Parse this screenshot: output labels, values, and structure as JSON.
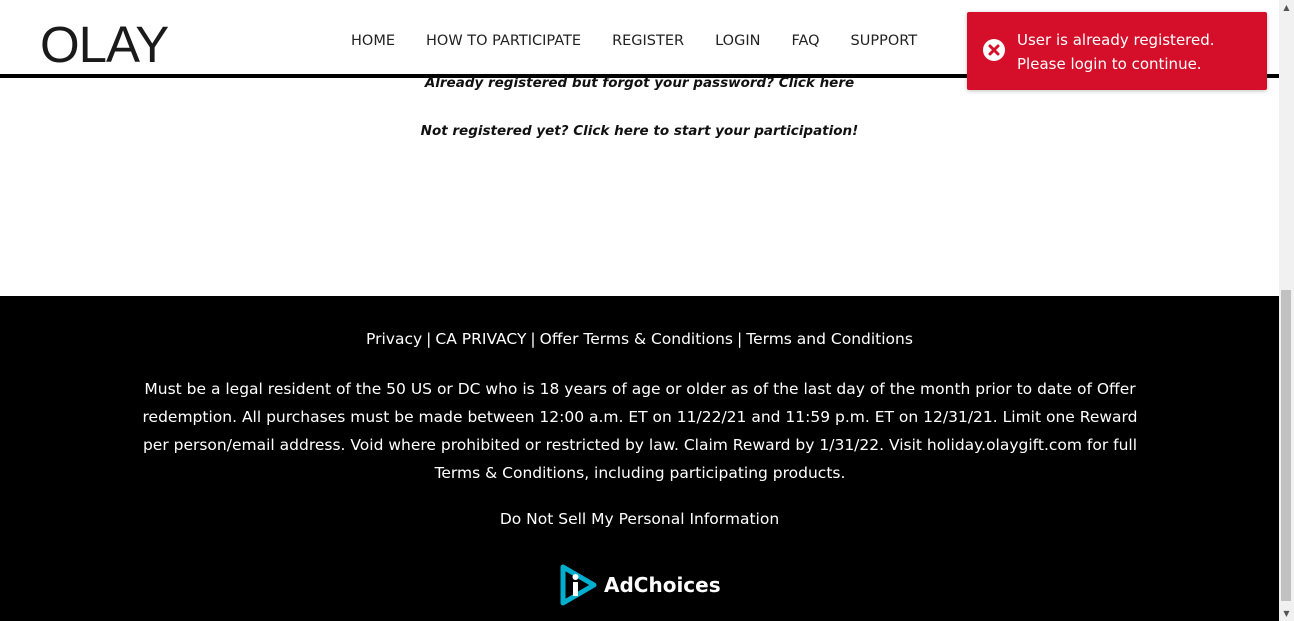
{
  "header": {
    "logo_text": "OLAY",
    "nav": [
      "HOME",
      "HOW TO PARTICIPATE",
      "REGISTER",
      "LOGIN",
      "FAQ",
      "SUPPORT"
    ]
  },
  "main": {
    "forgot_password_text": "Already registered but forgot your password? Click here",
    "not_registered_text": "Not registered yet? Click here to start your participation!"
  },
  "toast": {
    "icon": "error-x-icon",
    "line1": "User is already registered.",
    "line2": "Please login to continue.",
    "background": "#d50f2a"
  },
  "footer": {
    "links": [
      "Privacy",
      "CA PRIVACY",
      "Offer Terms & Conditions",
      "Terms and Conditions"
    ],
    "separator": "|",
    "disclaimer": "Must be a legal resident of the 50 US or DC who is 18 years of age or older as of the last day of the month prior to date of Offer redemption. All purchases must be made between 12:00 a.m. ET on 11/22/21 and 11:59 p.m. ET on 12/31/21. Limit one Reward per person/email address. Void where prohibited or restricted by law. Claim Reward by 1/31/22. Visit holiday.olaygift.com for full Terms & Conditions, including participating products.",
    "do_not_sell": "Do Not Sell My Personal Information",
    "adchoices_label": "AdChoices",
    "adchoices_icon": "adchoices-icon",
    "adchoices_color": "#00aecd"
  },
  "scrollbar": {
    "up_icon": "scroll-up-arrow-icon",
    "down_icon": "scroll-down-arrow-icon"
  }
}
